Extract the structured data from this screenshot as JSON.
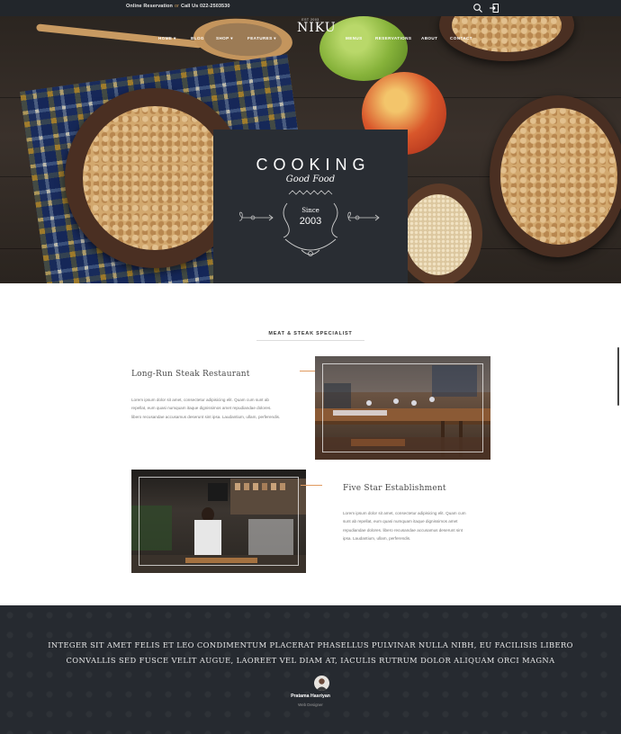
{
  "topbar": {
    "reservation_label": "Online Reservation",
    "separator": "or",
    "call_label": "Call Us 022-2503530",
    "icons": [
      "search-icon",
      "login-icon"
    ]
  },
  "nav": {
    "logo_est": "EST 2003",
    "logo_name": "NIKU",
    "left_items": [
      "HOME ▾",
      "BLOG",
      "SHOP ▾",
      "FEATURES ▾"
    ],
    "right_items": [
      "MENUS",
      "RESERVATIONS",
      "ABOUT",
      "CONTACT"
    ]
  },
  "hero": {
    "title": "COOKING",
    "subtitle": "Good Food",
    "since_label": "Since",
    "year": "2003"
  },
  "section": {
    "title": "MEAT & STEAK SPECIALIST"
  },
  "features": [
    {
      "title": "Long-Run Steak Restaurant",
      "text": [
        "Lorem ipsum dolor sit amet, consectetur adipisicing elit. Quam cum sunt ab",
        "repellat, eum quasi numquam itaque dignissimos amet repudiandae dolores.",
        "libero recusandae accusamus deserunt sint ipsa. Laudantium, ullam, perferendis."
      ]
    },
    {
      "title": "Five Star Establishment",
      "text": [
        "Lorem ipsum dolor sit amet, consectetur adipisicing elit. Quam cum",
        "sunt ab repellat, eum quasi numquam itaque dignissimos amet",
        "repudiandae dolores. libero recusandae accusamus deserunt sint",
        "ipsa. Laudantium, ullam, perferendis."
      ]
    }
  ],
  "testimonial": {
    "quote_lines": [
      "INTEGER SIT AMET FELIS ET LEO CONDIMENTUM PLACERAT PHASELLUS PULVINAR NULLA NIBH, EU FACILISIS LIBERO",
      "CONVALLIS SED FUSCE VELIT AUGUE, LAOREET VEL DIAM AT, IACULIS RUTRUM DOLOR ALIQUAM ORCI MAGNA"
    ],
    "author": "Pratama Hasriyan",
    "role": "Web Designer"
  },
  "colors": {
    "dark": "#22262b",
    "badge": "#292d33",
    "accent": "#e09a5f",
    "testimonial_bg": "#262a30"
  }
}
